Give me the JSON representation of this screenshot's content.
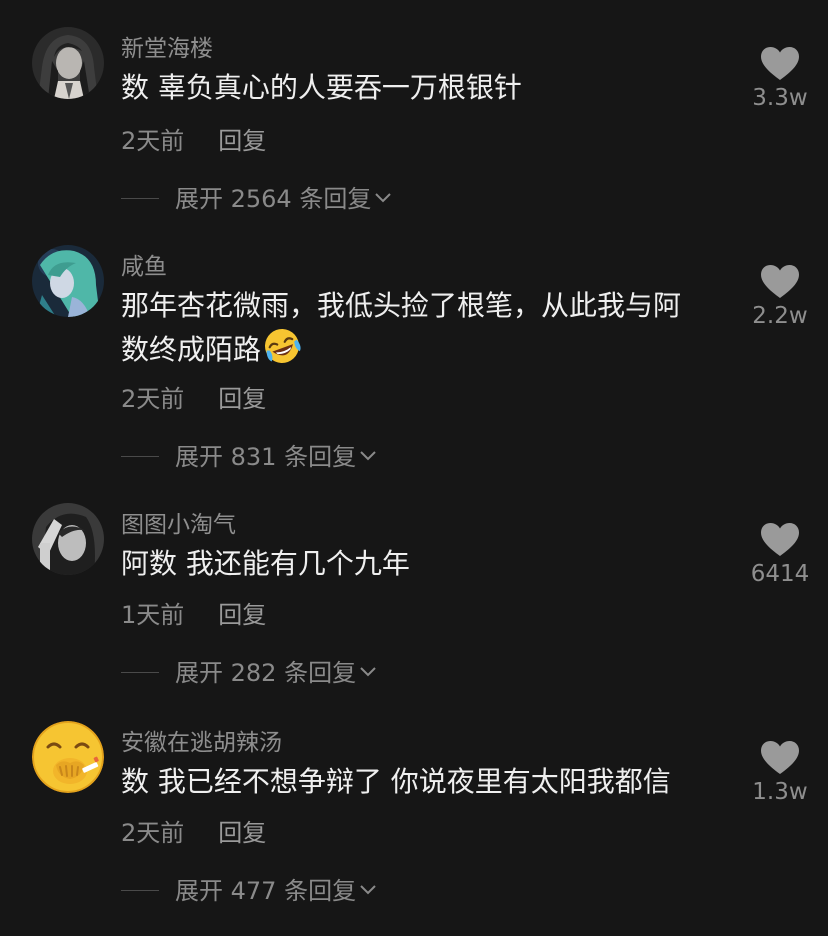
{
  "comments": [
    {
      "username": "新堂海楼",
      "text": "数 辜负真心的人要吞一万根银针",
      "time": "2天前",
      "reply_label": "回复",
      "expand_label": "展开 2564 条回复",
      "likes": "3.3w",
      "avatar_icon": "avatar-anime-man"
    },
    {
      "username": "咸鱼",
      "text_line1": "那年杏花微雨，我低头捡了根笔，从此我与阿",
      "text_line2": "数终成陌路",
      "emoji": "rolling-laughing-emoji",
      "time": "2天前",
      "reply_label": "回复",
      "expand_label": "展开 831 条回复",
      "likes": "2.2w",
      "avatar_icon": "avatar-anime-teal-hair"
    },
    {
      "username": "图图小淘气",
      "text": "阿数 我还能有几个九年",
      "time": "1天前",
      "reply_label": "回复",
      "expand_label": "展开 282 条回复",
      "likes": "6414",
      "avatar_icon": "avatar-grayscale-girl"
    },
    {
      "username": "安徽在逃胡辣汤",
      "text": "数 我已经不想争辩了 你说夜里有太阳我都信",
      "time": "2天前",
      "reply_label": "回复",
      "expand_label": "展开 477 条回复",
      "likes": "1.3w",
      "avatar_icon": "avatar-smoking-emoji"
    }
  ],
  "colors": {
    "background": "#161616",
    "text": "#efefef",
    "muted": "#8e8e8e",
    "heart": "#9a9a9a"
  }
}
